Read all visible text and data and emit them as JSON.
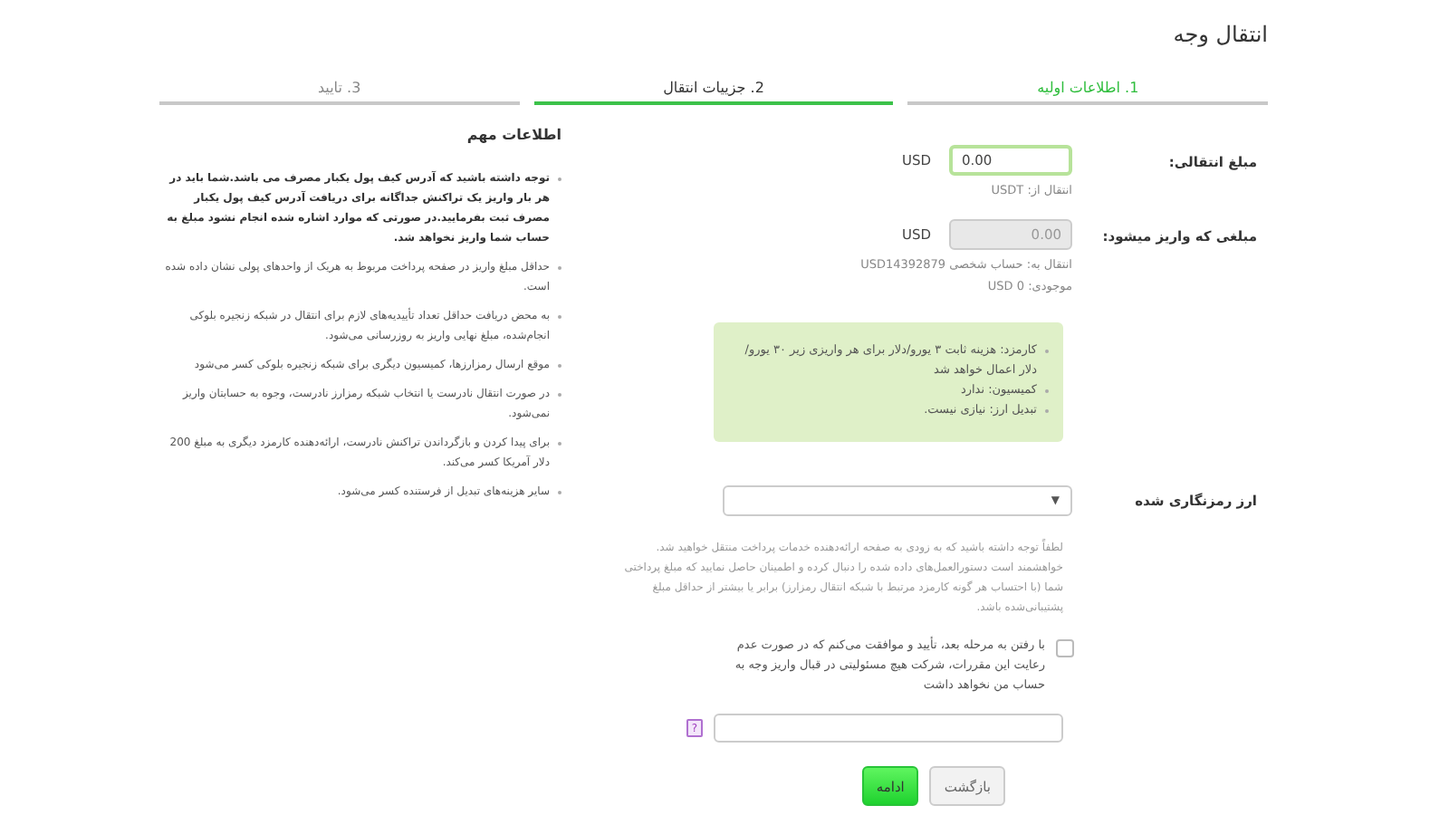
{
  "page_title": "انتقال وجه",
  "steps": [
    {
      "label": "1. اطلاعات اولیه",
      "selected": false,
      "completed": true
    },
    {
      "label": "2. جزییات انتقال",
      "selected": true,
      "completed": false
    },
    {
      "label": "3. تایید",
      "selected": false,
      "completed": false
    }
  ],
  "form": {
    "amount": {
      "label": "مبلغ انتقالی:",
      "value": "0.00",
      "currency": "USD",
      "focused": true,
      "notes": [
        "انتقال از: USDT"
      ]
    },
    "received": {
      "label": "مبلغی که واریز میشود:",
      "value": "0.00",
      "currency": "USD",
      "disabled": true,
      "notes": [
        "انتقال به: حساب شخصی USD14392879",
        "موجودی: 0 USD"
      ]
    },
    "fees": [
      "کارمزد: هزینه ثابت ۳ یورو/دلار برای هر واریزی زیر ۳۰ یورو/دلار اعمال خواهد شد",
      "کمیسیون: ندارد",
      "تبدیل ارز: نیازی نیست."
    ],
    "crypto": {
      "label": "ارز رمزنگاری شده",
      "arrow": "▼"
    },
    "notice": "لطفاً توجه داشته باشید که به زودی به صفحه ارائه‌دهنده خدمات پرداخت منتقل خواهید شد. خواهشمند است دستورالعمل‌های داده شده را دنبال کرده و اطمینان حاصل نمایید که مبلغ پرداختی شما (با احتساب هر گونه کارمزد مرتبط با شبکه انتقال رمزارز) برابر یا بیشتر از حداقل مبلغ پشتیبانی‌شده باشد.",
    "agreement": {
      "text": "با رفتن به مرحله بعد، تأیید و موافقت می‌کنم که در صورت عدم رعایت این مقررات، شرکت هیچ مسئولیتی در قبال واریز وجه به حساب من نخواهد داشت",
      "checked": false
    },
    "captcha": {
      "help": "?"
    },
    "buttons": [
      {
        "label": "بازگشت",
        "kind": "secondary"
      },
      {
        "label": "ادامه",
        "kind": "primary"
      }
    ]
  },
  "info": {
    "title": "اطلاعات مهم",
    "items": [
      {
        "text": "توجه داشته باشید که آدرس کیف پول یکبار مصرف می باشد.شما باید در هر بار واریز یک تراکنش جداگانه برای دریافت آدرس کیف پول یکبار مصرف ثبت بفرمایید.در صورتی که موارد اشاره شده انجام نشود مبلغ به حساب شما واریز نخواهد شد.",
        "bold": true
      },
      {
        "text": "حداقل مبلغ واریز در صفحه پرداخت مربوط به هریک از واحدهای پولی نشان داده شده است.",
        "bold": false
      },
      {
        "text": "به محض دریافت حداقل تعداد تأییدیه‌های لازم برای انتقال در شبکه زنجیره بلوکی انجام‌شده، مبلغ نهایی واریز به روزرسانی می‌شود.",
        "bold": false
      },
      {
        "text": "موقع ارسال رمزارزها، کمیسیون دیگری برای شبکه زنجیره بلوکی کسر می‌شود",
        "bold": false
      },
      {
        "text": "در صورت انتقال نادرست یا انتخاب شبکه رمزارز نادرست، وجوه به حسابتان واریز نمی‌شود.",
        "bold": false
      },
      {
        "text": "برای پیدا کردن و بازگرداندن تراکنش نادرست، ارائه‌دهنده کارمزد دیگری به مبلغ 200 دلار آمریکا کسر می‌کند.",
        "bold": false
      },
      {
        "text": "سایر هزینه‌های تبدیل از فرستنده کسر می‌شود.",
        "bold": false
      }
    ]
  }
}
